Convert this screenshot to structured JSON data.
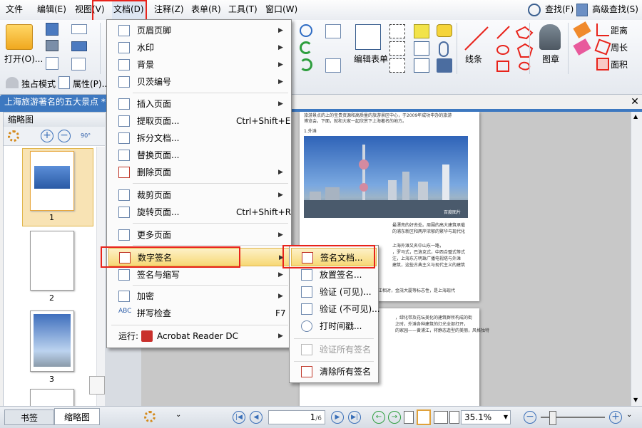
{
  "menubar": {
    "items": [
      "文件",
      "编辑(E)",
      "视图(V)",
      "文档(D)",
      "注释(Z)",
      "表单(R)",
      "工具(T)",
      "窗口(W)"
    ],
    "find": "查找(F)",
    "advanced_find": "高级查找(S)"
  },
  "ribbon": {
    "open": "打开(O)...",
    "read_mode": "独占模式",
    "properties": "属性(P)...",
    "edit_form": "编辑表单",
    "line": "线条",
    "stamp": "图章",
    "distance": "距离",
    "perimeter": "周长",
    "area": "面积"
  },
  "document_tab": "上海旅游著名的五大景点 *",
  "left_panel": {
    "title": "缩略图",
    "rotate_label": "90°",
    "pages": [
      "1",
      "2",
      "3"
    ],
    "tabs": [
      "书签",
      "缩略图"
    ]
  },
  "document": {
    "line1": "旅游景点的上的宝贵资源和高质量的旅游景区中心，于2009年成功申办的旅游",
    "line2": "博览会，下面，就和大家一起欣赏下上海著名的地方。",
    "heading": "1.外滩",
    "image_watermark": "百度图片",
    "para_lines": [
      "最漂亮的好去处。周围的高大建筑承载",
      "的浦东新区和两岸浓郁的繁华与现代化",
      "上海外滩又名中山东一路，",
      "，罗马式，巴洛克式，中西合璧式等式",
      "注，上海东方明珠广播电视塔与外滩",
      "建筑，这些古典主义与现代主义的建筑"
    ],
    "para_line_last": "外滩隔江相对，金茂大厦等标志性，是上海现代",
    "page2_lines": [
      "，绿化带及花坛美化的建筑群所构成的街",
      "之时，外滩各种建筑的灯光全部打开，",
      "的家园——黄浦江，将静态造型的美丽，风格独特"
    ]
  },
  "status": {
    "page_current": "1",
    "page_total": "/6",
    "zoom": "35.1%"
  },
  "doc_menu": {
    "items": [
      {
        "label": "页眉页脚",
        "shortcut": "",
        "arrow": true
      },
      {
        "label": "水印",
        "shortcut": "",
        "arrow": true
      },
      {
        "label": "背景",
        "shortcut": "",
        "arrow": true
      },
      {
        "label": "贝茨编号",
        "shortcut": "",
        "arrow": true
      },
      {
        "label": "插入页面",
        "shortcut": "",
        "arrow": true
      },
      {
        "label": "提取页面...",
        "shortcut": "Ctrl+Shift+E",
        "arrow": false
      },
      {
        "label": "拆分文档...",
        "shortcut": "",
        "arrow": false
      },
      {
        "label": "替换页面...",
        "shortcut": "",
        "arrow": false
      },
      {
        "label": "删除页面",
        "shortcut": "",
        "arrow": true
      },
      {
        "label": "裁剪页面",
        "shortcut": "",
        "arrow": true
      },
      {
        "label": "旋转页面...",
        "shortcut": "Ctrl+Shift+R",
        "arrow": false
      },
      {
        "label": "更多页面",
        "shortcut": "",
        "arrow": true
      },
      {
        "label": "数字签名",
        "shortcut": "",
        "arrow": true
      },
      {
        "label": "签名与缩写",
        "shortcut": "",
        "arrow": true
      },
      {
        "label": "加密",
        "shortcut": "",
        "arrow": true
      },
      {
        "label": "拼写检查",
        "shortcut": "F7",
        "arrow": false
      }
    ],
    "run_label": "运行:",
    "run_app": "Acrobat Reader DC"
  },
  "sign_menu": {
    "items": [
      "签名文档...",
      "放置签名...",
      "验证 (可见)...",
      "验证 (不可见)...",
      "打时间戳...",
      "验证所有签名",
      "清除所有签名"
    ]
  },
  "colors": {
    "accent_blue": "#3d78c0",
    "highlight_red": "#e8231b",
    "menu_highlight": "#f7d875"
  }
}
